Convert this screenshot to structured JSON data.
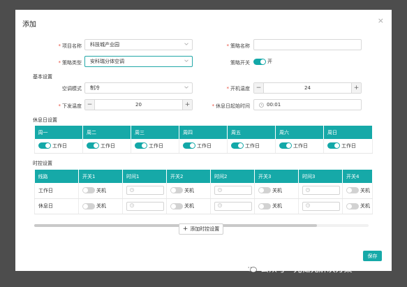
{
  "dialog": {
    "title": "添加",
    "close": "×",
    "save_label": "保存"
  },
  "form": {
    "project_name": {
      "label": "项目名称",
      "value": "科技城产业园"
    },
    "strategy_name": {
      "label": "策略名称",
      "value": ""
    },
    "strategy_type": {
      "label": "策略类型",
      "value": "安科瑞分体空调"
    },
    "strategy_switch": {
      "label": "策略开关",
      "value": "开"
    },
    "basic_section": "基本设置",
    "ac_mode": {
      "label": "空调模式",
      "value": "制冷"
    },
    "on_temp": {
      "label": "开机温度",
      "value": "24",
      "minus": "−",
      "plus": "+"
    },
    "down_temp": {
      "label": "下发温度",
      "value": "20",
      "minus": "−",
      "plus": "+"
    },
    "rest_start": {
      "label": "休息日起始时间",
      "value": "00:01"
    }
  },
  "rest_day": {
    "title": "休息日设置",
    "days": [
      "周一",
      "周二",
      "周三",
      "周四",
      "周五",
      "周六",
      "周日"
    ],
    "toggle_label": "工作日"
  },
  "time_control": {
    "title": "时控设置",
    "headers": [
      "线路",
      "开关1",
      "时间1",
      "开关2",
      "时间2",
      "开关3",
      "时间3",
      "开关4"
    ],
    "rows": [
      {
        "name": "工作日",
        "switch_label": "关机"
      },
      {
        "name": "休息日",
        "switch_label": "关机"
      }
    ],
    "add_label": "添加时控设置",
    "add_icon": "+"
  },
  "watermark": {
    "text": "公众号 · 光储充解决方案",
    "icon": "wechat-icon"
  },
  "colors": {
    "accent": "#16a9a8",
    "required": "#e74c3c",
    "overlay": "#4d4d4d"
  }
}
